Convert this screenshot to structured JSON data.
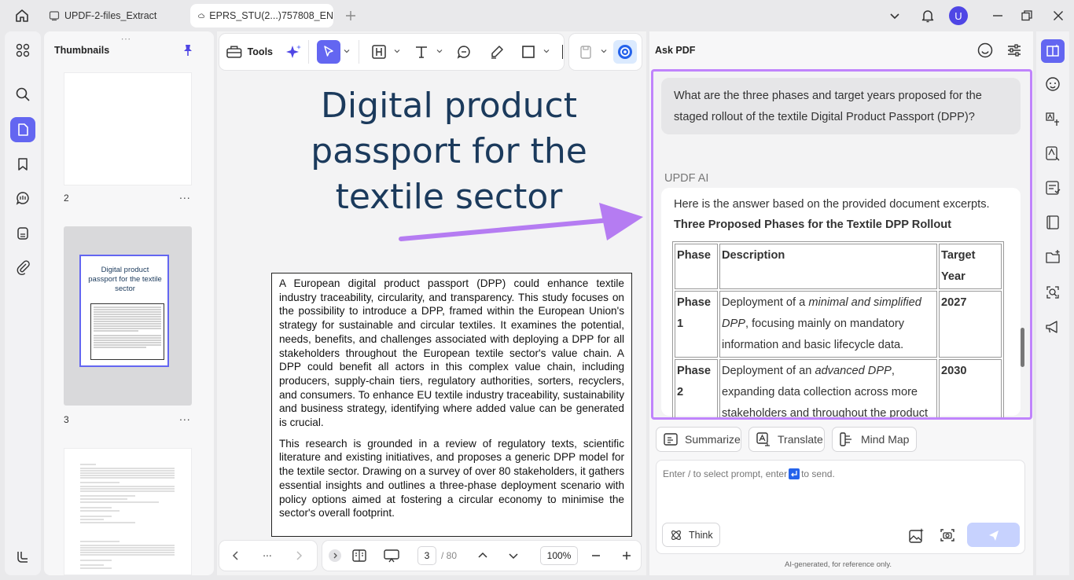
{
  "tabs": [
    {
      "label": "UPDF-2-files_Extract"
    },
    {
      "label": "EPRS_STU(2...)757808_EN"
    }
  ],
  "user_avatar_letter": "U",
  "thumbnails": {
    "title": "Thumbnails",
    "pages": [
      {
        "number": "2",
        "more": "..."
      },
      {
        "number": "3",
        "more": "..."
      }
    ],
    "thumb3_title": "Digital product passport for the textile sector"
  },
  "toolbar": {
    "tools_label": "Tools"
  },
  "document": {
    "title_lines": [
      "Digital product",
      "passport for the",
      "textile sector"
    ],
    "paragraphs": [
      "A European digital product passport (DPP) could enhance textile industry traceability, circularity, and transparency. This study focuses on the possibility to introduce a DPP, framed within the European Union's strategy for sustainable and circular textiles. It examines the potential, needs, benefits, and challenges associated with deploying a DPP for all stakeholders throughout the European textile sector's value chain. A DPP could benefit all actors in this complex value chain, including producers, supply-chain tiers, regulatory authorities, sorters, recyclers, and consumers. To enhance EU textile industry traceability, sustainability and business strategy, identifying where added value can be generated is crucial.",
      "This research is grounded in a review of regulatory texts, scientific literature and existing initiatives, and proposes a generic DPP model for the textile sector. Drawing on a survey of over 80 stakeholders, it gathers essential insights and outlines a three-phase deployment scenario with policy options aimed at fostering a circular economy to minimise the sector's overall footprint."
    ]
  },
  "bottom": {
    "more": "...",
    "page_current": "3",
    "page_total": "/ 80",
    "zoom": "100%"
  },
  "ask_pdf": {
    "title": "Ask PDF",
    "question": "What are the three phases and target years proposed for the staged rollout of the textile Digital Product Passport (DPP)?",
    "ai_label": "UPDF AI",
    "answer_intro": "Here is the answer based on the provided document excerpts.",
    "answer_heading": "Three Proposed Phases for the Textile DPP Rollout",
    "table_headers": [
      "Phase",
      "Description",
      "Target Year"
    ],
    "rows": [
      {
        "phase": "Phase 1",
        "desc_pre": "Deployment of a ",
        "desc_em": "minimal and simplified DPP",
        "desc_post": ", focusing mainly on mandatory information and basic lifecycle data.",
        "year": "2027"
      },
      {
        "phase": "Phase 2",
        "desc_pre": "Deployment of an ",
        "desc_em": "advanced DPP",
        "desc_post": ", expanding data collection across more stakeholders and throughout the product lifecycle",
        "year": "2030"
      }
    ],
    "quick_actions": [
      "Summarize",
      "Translate",
      "Mind Map"
    ],
    "input_placeholder_pre": "Enter / to select prompt, enter ",
    "input_placeholder_post": "to send.",
    "think_label": "Think",
    "disclaimer": "AI-generated, for reference only."
  },
  "colors": {
    "accent": "#6366f1",
    "highlight_border": "#c084fc",
    "arrow": "#b57cf2",
    "doc_title": "#1b3a5c"
  }
}
